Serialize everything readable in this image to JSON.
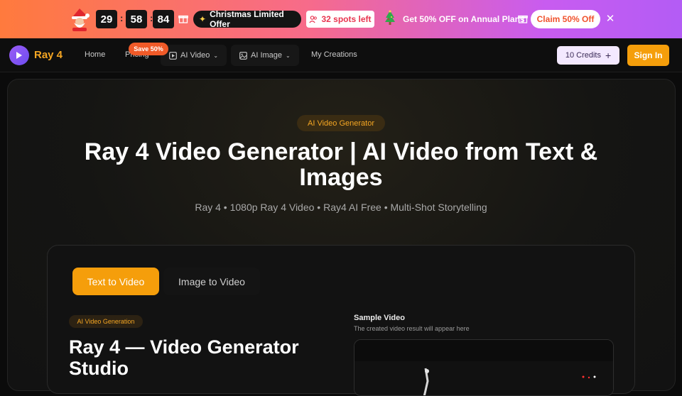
{
  "banner": {
    "timer": [
      "29",
      "58",
      "84"
    ],
    "offer_label": "Christmas Limited Offer",
    "spots_label": "32 spots left",
    "annual_label": "Get 50% OFF on Annual Plans",
    "claim_label": "Claim 50% Off"
  },
  "nav": {
    "brand": "Ray 4",
    "links": [
      "Home",
      "Pricing"
    ],
    "save_badge": "Save 50%",
    "ai_video": "AI Video",
    "ai_image": "AI Image",
    "my_creations": "My Creations",
    "credits": "10 Credits",
    "sign_in": "Sign In"
  },
  "hero": {
    "badge": "AI Video Generator",
    "title": "Ray 4 Video Generator | AI Video from Text & Images",
    "subtitle": "Ray 4 • 1080p Ray 4 Video • Ray4 AI Free • Multi-Shot Storytelling"
  },
  "generator": {
    "tabs": [
      "Text to Video",
      "Image to Video"
    ],
    "badge": "AI Video Generation",
    "title": "Ray 4 — Video Generator Studio",
    "sample_label": "Sample Video",
    "sample_sub": "The created video result will appear here"
  },
  "colors": {
    "accent": "#f59e0b",
    "brand": "#f5a623",
    "banner_start": "#ff7a3d",
    "banner_end": "#b35cf5"
  }
}
